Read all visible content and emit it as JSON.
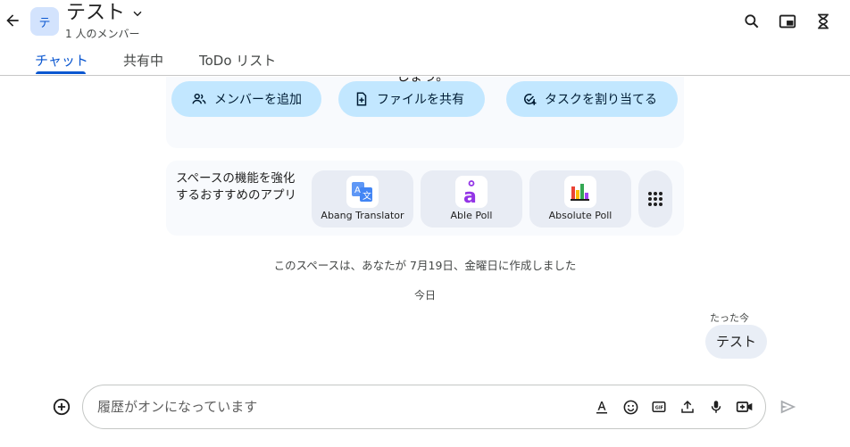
{
  "header": {
    "avatar_letter": "テ",
    "title": "テスト",
    "member_count": "1 人のメンバー"
  },
  "tabs": [
    {
      "label": "チャット",
      "active": true
    },
    {
      "label": "共有中",
      "active": false
    },
    {
      "label": "ToDo リスト",
      "active": false
    }
  ],
  "intro": {
    "cut_text": "しょう。",
    "actions": [
      {
        "label": "メンバーを追加",
        "icon": "people-icon"
      },
      {
        "label": "ファイルを共有",
        "icon": "file-add-icon"
      },
      {
        "label": "タスクを割り当てる",
        "icon": "task-add-icon"
      }
    ]
  },
  "apps": {
    "label": "スペースの機能を強化するおすすめのアプリ",
    "items": [
      {
        "name": "Abang Translator",
        "icon": "translate-app-icon"
      },
      {
        "name": "Able Poll",
        "icon": "able-poll-icon"
      },
      {
        "name": "Absolute Poll",
        "icon": "absolute-poll-icon"
      }
    ]
  },
  "timeline": {
    "created_message": "このスペースは、あなたが 7月19日、金曜日に作成しました",
    "date_divider": "今日"
  },
  "message": {
    "time": "たった今",
    "text": "テスト"
  },
  "composer": {
    "placeholder": "履歴がオンになっています"
  },
  "colors": {
    "accent": "#0b57d0",
    "pill_bg": "#c2e7ff",
    "card_bg": "#f8fafd"
  }
}
